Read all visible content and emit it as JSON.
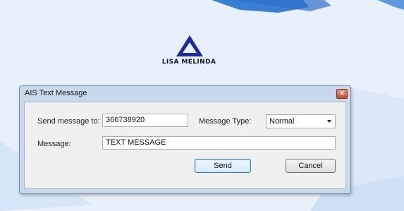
{
  "map": {
    "vessel": {
      "name": "LISA MELINDA",
      "icon": "vessel-triangle-icon",
      "color": "#1e2a9c"
    }
  },
  "dialog": {
    "title": "AIS Text Message",
    "close_icon": "close-icon",
    "send_to_label": "Send message to:",
    "send_to_value": "366738920",
    "message_type_label": "Message Type:",
    "message_type_value": "Normal",
    "message_label": "Message:",
    "message_value": "TEXT MESSAGE",
    "send_button": "Send",
    "cancel_button": "Cancel"
  }
}
